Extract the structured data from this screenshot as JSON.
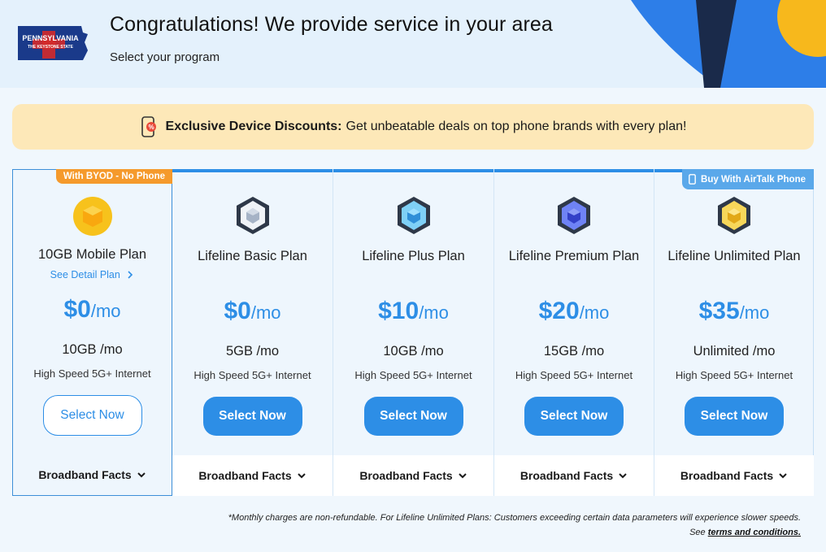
{
  "hero": {
    "title": "Congratulations! We provide service in your area",
    "subtitle": "Select your program",
    "state_logo_line1": "PENNSYLVANIA",
    "state_logo_line2": "THE KEYSTONE STATE"
  },
  "banner": {
    "icon": "phone-discount-icon",
    "bold": "Exclusive Device Discounts:",
    "text": "Get unbeatable deals on top phone brands with every plan!"
  },
  "plans": [
    {
      "tag": "With BYOD - No Phone",
      "name": "10GB Mobile Plan",
      "detail_link": "See Detail Plan",
      "price": "$0",
      "unit": "/mo",
      "data": "10GB /mo",
      "speed": "High Speed 5G+ Internet",
      "button": "Select Now",
      "facts": "Broadband Facts",
      "badge_color": "#f7c21c"
    },
    {
      "name": "Lifeline Basic Plan",
      "price": "$0",
      "unit": "/mo",
      "data": "5GB /mo",
      "speed": "High Speed 5G+ Internet",
      "button": "Select Now",
      "facts": "Broadband Facts",
      "badge_color": "#a6b3c6"
    },
    {
      "name": "Lifeline Plus Plan",
      "price": "$10",
      "unit": "/mo",
      "data": "10GB /mo",
      "speed": "High Speed 5G+ Internet",
      "button": "Select Now",
      "facts": "Broadband Facts",
      "badge_color": "#4fb0ec"
    },
    {
      "name": "Lifeline Premium Plan",
      "price": "$20",
      "unit": "/mo",
      "data": "15GB /mo",
      "speed": "High Speed 5G+ Internet",
      "button": "Select Now",
      "facts": "Broadband Facts",
      "badge_color": "#4b5fe0"
    },
    {
      "tag": "Buy With AirTalk Phone",
      "name": "Lifeline Unlimited Plan",
      "price": "$35",
      "unit": "/mo",
      "data": "Unlimited /mo",
      "speed": "High Speed 5G+ Internet",
      "button": "Select Now",
      "facts": "Broadband Facts",
      "badge_color": "#f3c430"
    }
  ],
  "footnote": {
    "line1": "*Monthly charges are non-refundable. For Lifeline Unlimited Plans: Customers exceeding certain data parameters will experience slower speeds.",
    "see": "See",
    "link": "terms and conditions."
  },
  "colors": {
    "accent": "#2d8ee6",
    "banner_bg": "#fde8b8",
    "byod_tag": "#f59a2c",
    "airtalk_tag": "#5aa8ea"
  }
}
